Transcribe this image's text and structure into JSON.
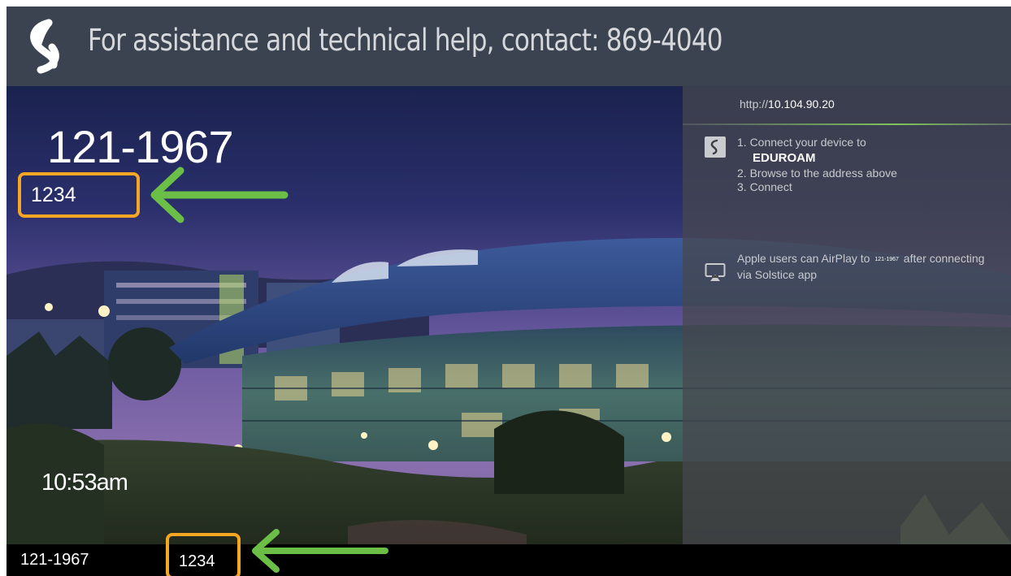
{
  "header": {
    "logo_icon": "solstice-logo-icon",
    "help_text": "For assistance and technical help, contact: 869-4040"
  },
  "panel": {
    "url_prefix": "http://",
    "url_address": "10.104.90.20",
    "steps": {
      "step1": "1. Connect your device to",
      "network_name": "EDUROAM",
      "step2": "2. Browse to the address above",
      "step3": "3. Connect"
    },
    "airplay": {
      "icon": "airplay-icon",
      "text_before": "Apple users can AirPlay to",
      "display_name": "121-1967",
      "text_after": "after connecting via Solstice app"
    }
  },
  "overlay": {
    "display_name": "121-1967",
    "screen_key": "1234",
    "clock": "10:53am",
    "bottom_display_name": "121-1967",
    "bottom_screen_key": "1234"
  },
  "colors": {
    "header_bg": "#3b4350",
    "highlight_box": "#f5a623",
    "arrow": "#6cbf46",
    "url_underline": "#7dc45a"
  }
}
